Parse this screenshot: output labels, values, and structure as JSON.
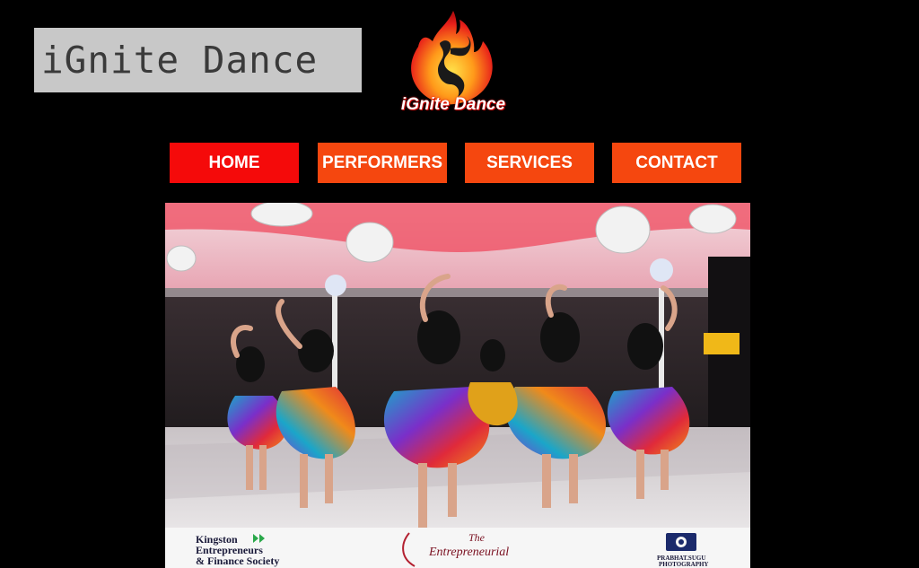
{
  "header": {
    "site_title": "iGnite Dance",
    "logo_text": "iGnite Dance"
  },
  "nav": {
    "items": [
      {
        "label": "HOME",
        "active": true
      },
      {
        "label": "PERFORMERS",
        "active": false
      },
      {
        "label": "SERVICES",
        "active": false
      },
      {
        "label": "CONTACT",
        "active": false
      }
    ]
  },
  "hero": {
    "banner": {
      "sponsor_1_line1": "Kingston",
      "sponsor_1_line2": "Entrepreneurs",
      "sponsor_1_line3": "& Finance Society",
      "sponsor_2_line1": "The",
      "sponsor_2_line2": "Entrepreneurial",
      "sponsor_3_line1": "PRABHAT.SUGU",
      "sponsor_3_line2": "PHOTOGRAPHY"
    }
  },
  "colors": {
    "background": "#000000",
    "nav_active": "#f50a0a",
    "nav_default": "#f5470f",
    "title_box": "#c8c8c8"
  }
}
